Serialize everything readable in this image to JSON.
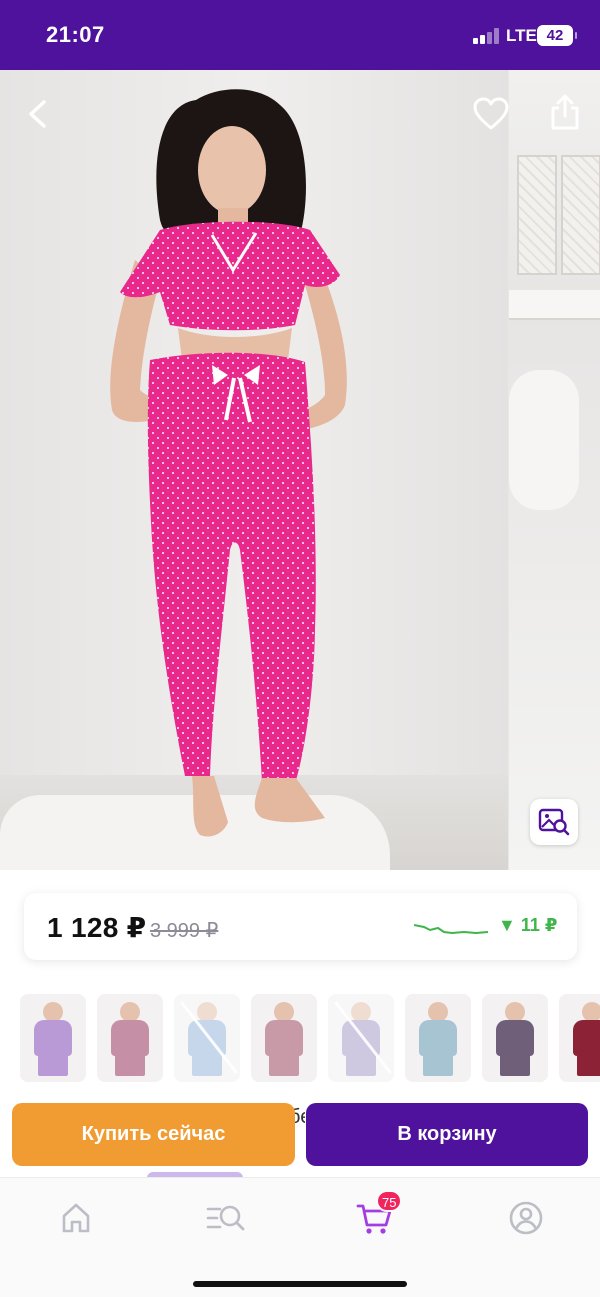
{
  "status_bar": {
    "time": "21:07",
    "network": "LTE",
    "battery": "42"
  },
  "gallery": {
    "icons": {
      "back": "chevron-left-icon",
      "favorite": "heart-icon",
      "share": "share-icon",
      "visual_search": "image-search-icon"
    }
  },
  "price": {
    "current": "1 128 ₽",
    "old": "3 999 ₽",
    "drop": "▼ 11 ₽",
    "drop_color": "#3fb54a"
  },
  "variants": [
    {
      "color": "#b99ad6",
      "available": true
    },
    {
      "color": "#c58fa6",
      "available": true
    },
    {
      "color": "#9bb7dc",
      "available": false
    },
    {
      "color": "#c89aa8",
      "available": true
    },
    {
      "color": "#a99cc9",
      "available": false
    },
    {
      "color": "#a7c4d3",
      "available": true
    },
    {
      "color": "#6f5f78",
      "available": true
    },
    {
      "color": "#8c2235",
      "available": true
    }
  ],
  "actions": {
    "buy_now": "Купить сейчас",
    "add_to_cart": "В корзину",
    "behind_text": "бе"
  },
  "bottom_nav": {
    "items": [
      "home-icon",
      "catalog-search-icon",
      "cart-icon",
      "profile-icon"
    ],
    "cart_badge": "75",
    "active_color": "#a53ee0"
  },
  "colors": {
    "brand": "#4f129c",
    "buy_now": "#f19c32",
    "badge": "#f0255e"
  }
}
